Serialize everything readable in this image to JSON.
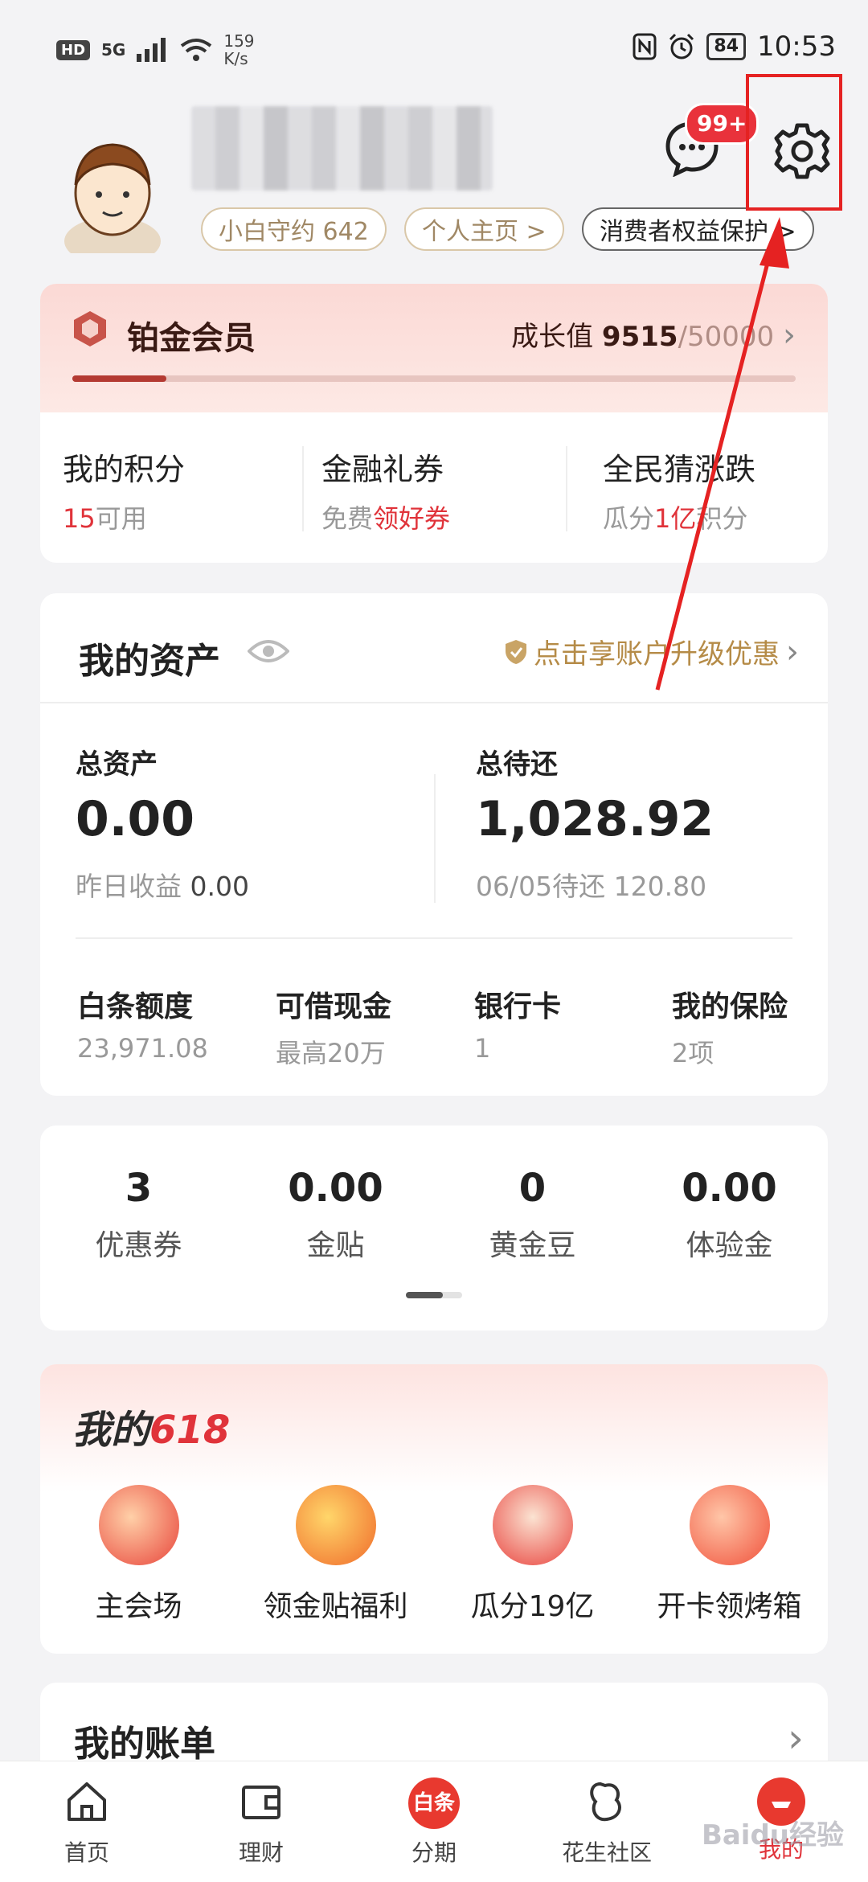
{
  "status_bar": {
    "hd": "HD",
    "signal": "5G",
    "speed_value": "159",
    "speed_unit": "K/s",
    "battery": "84",
    "time": "10:53"
  },
  "header": {
    "pill_credit": "小白守约 642",
    "pill_profile": "个人主页 >",
    "pill_protect": "消费者权益保护 >",
    "msg_badge": "99+"
  },
  "member": {
    "title": "铂金会员",
    "growth_label": "成长值",
    "growth_value": "9515",
    "growth_target": "/50000",
    "progress_fraction": 0.13,
    "items": [
      {
        "title": "我的积分",
        "sub_hi": "15",
        "sub_lo": "可用"
      },
      {
        "title": "金融礼券",
        "sub_lo": "免费",
        "sub_hi": "领好券"
      },
      {
        "title": "全民猜涨跌",
        "sub_lo": "瓜分",
        "sub_hi": "1亿",
        "sub_tail": "积分"
      }
    ]
  },
  "assets": {
    "title": "我的资产",
    "upgrade": "点击享账户升级优惠",
    "total_label": "总资产",
    "total_value": "0.00",
    "yesterday_label": "昨日收益",
    "yesterday_value": "0.00",
    "repay_label": "总待还",
    "repay_value": "1,028.92",
    "repay_date": "06/05待还",
    "repay_due": "120.80",
    "quads": [
      {
        "title": "白条额度",
        "sub": "23,971.08"
      },
      {
        "title": "可借现金",
        "sub": "最高20万"
      },
      {
        "title": "银行卡",
        "sub": "1"
      },
      {
        "title": "我的保险",
        "sub": "2项"
      }
    ]
  },
  "coupons": [
    {
      "value": "3",
      "label": "优惠券"
    },
    {
      "value": "0.00",
      "label": "金贴"
    },
    {
      "value": "0",
      "label": "黄金豆"
    },
    {
      "value": "0.00",
      "label": "体验金"
    }
  ],
  "p618": {
    "title_a": "我的",
    "title_b": "618",
    "acts": [
      {
        "label": "主会场",
        "color": "#e8443a"
      },
      {
        "label": "领金贴福利",
        "color": "#f06a2a"
      },
      {
        "label": "瓜分19亿",
        "color": "#e9453f"
      },
      {
        "label": "开卡领烤箱",
        "color": "#f0503a"
      }
    ]
  },
  "bill": {
    "title": "我的账单"
  },
  "tabs": [
    {
      "label": "首页"
    },
    {
      "label": "理财"
    },
    {
      "label": "分期",
      "icon_text": "白条"
    },
    {
      "label": "花生社区"
    },
    {
      "label": "我的"
    }
  ],
  "watermark": "Baidu经验"
}
